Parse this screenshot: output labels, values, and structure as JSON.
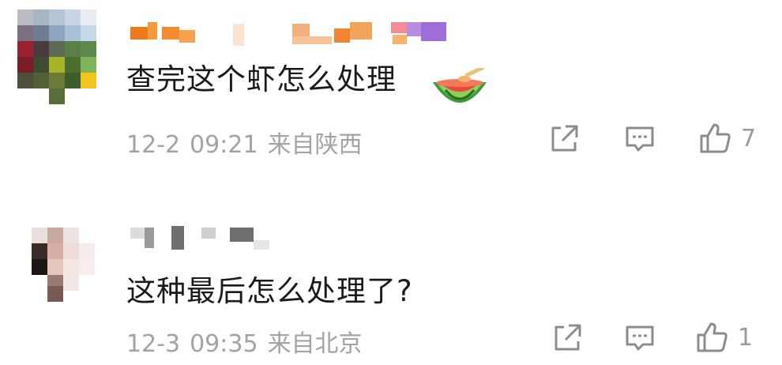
{
  "comments": [
    {
      "text": "查完这个虾怎么处理",
      "emoji_icon": "watermelon-icon",
      "date": "12-2",
      "time": "09:21",
      "location": "来自陕西",
      "likes": "7"
    },
    {
      "text": "这种最后怎么处理了?",
      "date": "12-3",
      "time": "09:35",
      "location": "来自北京",
      "likes": "1"
    }
  ],
  "icons": {
    "share": "share-icon",
    "reply": "comment-icon",
    "like": "thumbs-up-icon"
  },
  "colors": {
    "text": "#1a1a1a",
    "meta": "#a3a3a3",
    "icon": "#8c8c8c"
  }
}
